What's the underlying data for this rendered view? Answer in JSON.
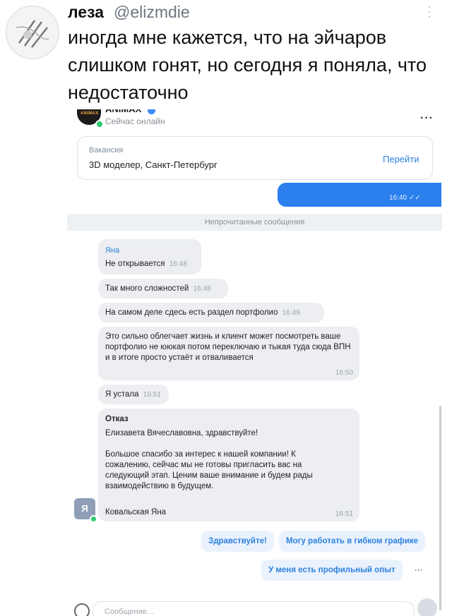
{
  "tweet": {
    "display_name": "леза",
    "handle": "@elizmdie",
    "text": "иногда мне кажется, что на эйчаров слишком гонят, но сегодня я поняла, что недостаточно"
  },
  "chat": {
    "company_name": "ANIMAX",
    "status": "Сейчас онлайн",
    "vacancy": {
      "label": "Вакансия",
      "title": "3D моделер, Санкт-Петербург",
      "action": "Перейти"
    },
    "outgoing_time": "16:40",
    "unread_label": "Непрочитанные сообщения",
    "messages": [
      {
        "sender": "Яна",
        "text": "Не открывается",
        "time": "16:48"
      },
      {
        "text": "Так много сложностей",
        "time": "16:48"
      },
      {
        "text": "На самом деле сдесь есть раздел портфолио",
        "time": "16:49"
      },
      {
        "text": "Это сильно облегчает жизнь и клиент может посмотреть ваше портфолио не ююкая потом переключаю и тыкая туда сюда ВПН и в итоге просто устаёт и отваливается",
        "time": "16:50"
      },
      {
        "text": "Я устала",
        "time": "16:51"
      }
    ],
    "rejection": {
      "title": "Отказ",
      "greeting": "Елизавета Вячеславовна, здравствуйте!",
      "body": "Большое спасибо за интерес к нашей компании! К сожалению, сейчас мы не готовы пригласить вас на следующий этап. Ценим ваше внимание и будем рады взаимодействию в будущем.",
      "signature": "Ковальская Яна",
      "time": "16:51"
    },
    "avatar_letter": "Я",
    "quick_replies": [
      "Здравствуйте!",
      "Могу работать в гибком графике",
      "У меня есть профильный опыт"
    ],
    "more_label": "···",
    "input_placeholder": "Сообщение..."
  },
  "colors": {
    "accent": "#2d81e0",
    "outgoing_bubble": "#2c80ee",
    "incoming_bubble": "#eceef1",
    "online": "#2ecc71"
  }
}
